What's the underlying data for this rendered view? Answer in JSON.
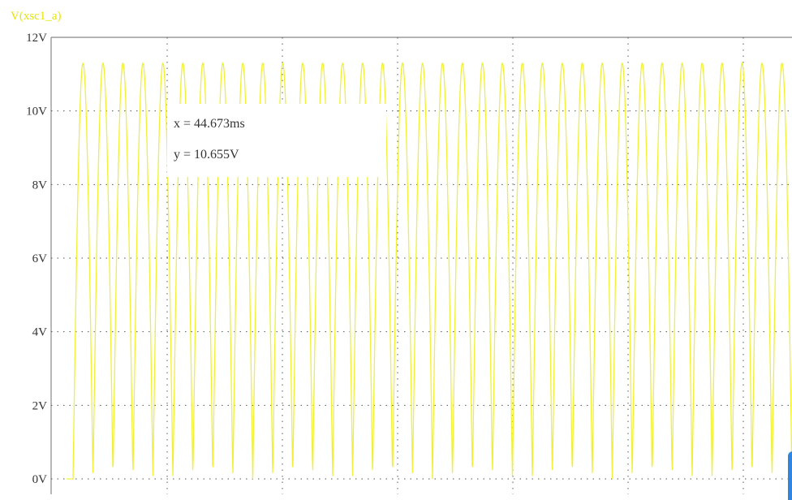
{
  "chart_data": {
    "type": "line",
    "title": "",
    "xlabel": "",
    "ylabel": "",
    "series": [
      {
        "name": "V(xsc1_a)",
        "color": "#f0f03a",
        "amplitude": 11.3,
        "offset": 0.0,
        "cycles_visible": 36
      }
    ],
    "ylim": [
      0,
      12
    ],
    "yticks": [
      0,
      2,
      4,
      6,
      8,
      10,
      12
    ],
    "ytick_labels": [
      "0V",
      "2V",
      "4V",
      "6V",
      "8V",
      "10V",
      "12V"
    ],
    "xgrid_count": 6,
    "grid": true,
    "legend": "top-left"
  },
  "series_label": "V(xsc1_a)",
  "cursor": {
    "x_text": "x = 44.673ms",
    "y_text": "y = 10.655V"
  },
  "colors": {
    "trace": "#f0f03a",
    "label": "#e6e600",
    "grid": "#555555",
    "axis": "#888888"
  }
}
